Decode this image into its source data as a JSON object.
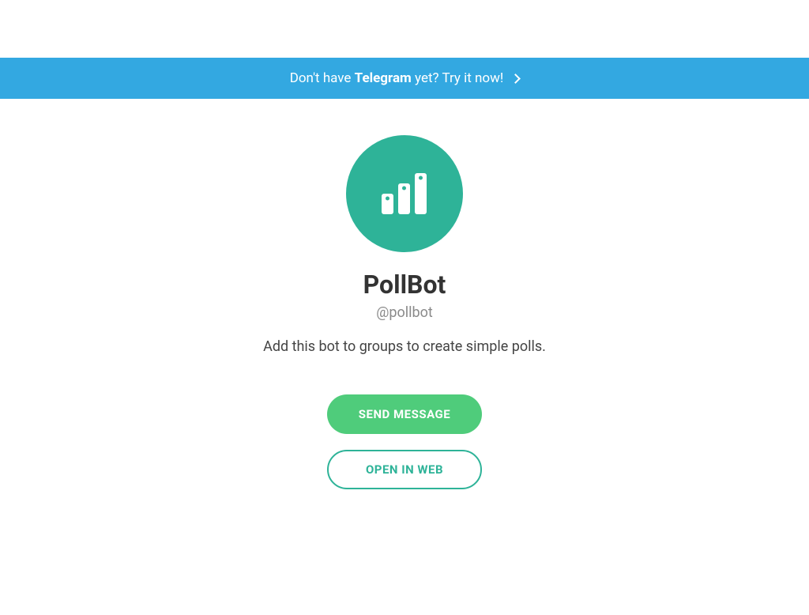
{
  "banner": {
    "prefix": "Don't have ",
    "bold": "Telegram",
    "suffix": " yet? Try it now!"
  },
  "profile": {
    "name": "PollBot",
    "username": "@pollbot",
    "description": "Add this bot to groups to create simple polls."
  },
  "buttons": {
    "send_message": "SEND MESSAGE",
    "open_in_web": "OPEN IN WEB"
  },
  "colors": {
    "banner_bg": "#33a8e1",
    "avatar_bg": "#2eb398",
    "primary_btn": "#4fcc7b",
    "secondary_btn_border": "#2eb398"
  }
}
